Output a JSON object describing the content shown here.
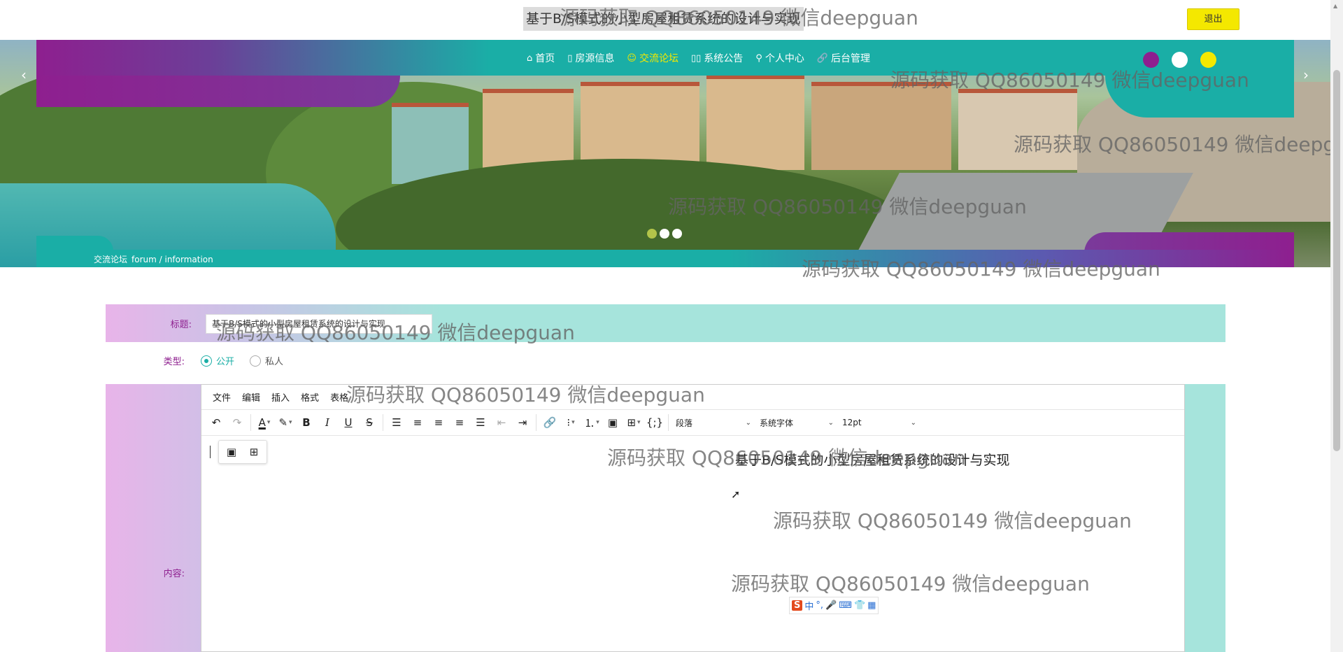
{
  "header": {
    "site_title": "基于B/S模式的小型房屋租赁系统的设计与实现",
    "logout_label": "退出"
  },
  "nav": {
    "items": [
      {
        "label": "首页",
        "icon": "home-icon",
        "glyph": "⌂",
        "active": false
      },
      {
        "label": "房源信息",
        "icon": "bookmark-icon",
        "glyph": "▯",
        "active": false
      },
      {
        "label": "交流论坛",
        "icon": "chat-icon",
        "glyph": "☺",
        "active": true
      },
      {
        "label": "系统公告",
        "icon": "book-icon",
        "glyph": "▯▯",
        "active": false
      },
      {
        "label": "个人中心",
        "icon": "user-icon",
        "glyph": "⚲",
        "active": false
      },
      {
        "label": "后台管理",
        "icon": "link-icon",
        "glyph": "🔗",
        "active": false
      }
    ],
    "active_color": "#f4e800",
    "text_color": "#ffffff"
  },
  "carousel": {
    "prev_icon": "chevron-left-icon",
    "next_icon": "chevron-right-icon",
    "prev_glyph": "‹",
    "next_glyph": "›",
    "top_dots": [
      "#8e1f8f",
      "#ffffff",
      "#f4e800"
    ],
    "bottom_dots": [
      "#b3c44a",
      "#ffffff",
      "#ffffff"
    ]
  },
  "breadcrumb": {
    "title": "交流论坛",
    "subtitle": "forum / information"
  },
  "form": {
    "title_label": "标题:",
    "title_value": "基于B/S模式的小型房屋租赁系统的设计与实现",
    "type_label": "类型:",
    "type_options": [
      {
        "label": "公开",
        "checked": true
      },
      {
        "label": "私人",
        "checked": false
      }
    ],
    "content_label": "内容:"
  },
  "editor": {
    "menus": [
      "文件",
      "编辑",
      "插入",
      "格式",
      "表格"
    ],
    "block_format": "段落",
    "font_family": "系统字体",
    "font_size": "12pt",
    "content_text": "基于B/S模式的小型房屋租赁系统的设计与实现",
    "toolbar_icons": [
      "undo-icon",
      "redo-icon",
      "text-color-icon",
      "highlight-icon",
      "bold-icon",
      "italic-icon",
      "underline-icon",
      "strikethrough-icon",
      "line-height-icon",
      "align-left-icon",
      "align-center-icon",
      "align-right-icon",
      "align-justify-icon",
      "outdent-icon",
      "indent-icon",
      "link-icon",
      "bullet-list-icon",
      "numbered-list-icon",
      "image-icon",
      "table-icon",
      "code-icon"
    ],
    "quick_toolbar": [
      "image-icon",
      "table-icon"
    ]
  },
  "ime": {
    "logo": "S",
    "mode": "中",
    "items": [
      "°,",
      "🎤",
      "⌨",
      "👕",
      "▦"
    ]
  },
  "watermark": {
    "text": "源码获取 QQ86050149 微信deepguan"
  }
}
